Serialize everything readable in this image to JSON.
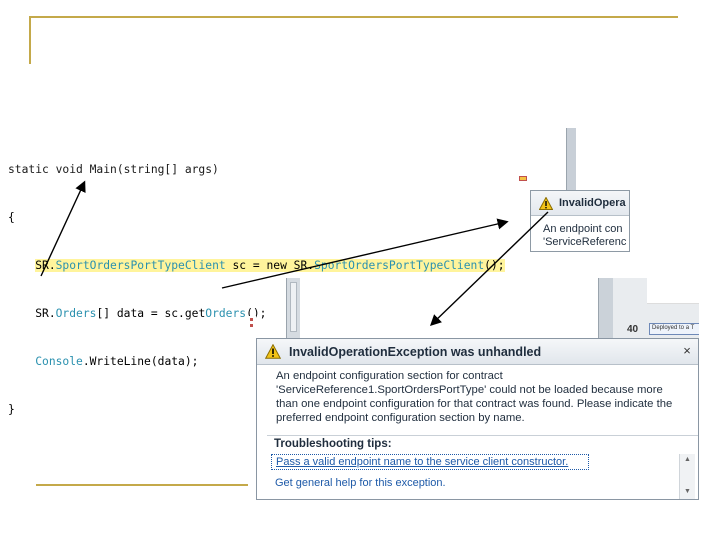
{
  "code": {
    "lines": [
      "static void Main(string[] args)",
      "{",
      "    SR.SportOrdersPortTypeClient sc = new SR.SportOrdersPortTypeClient();",
      "    SR.Orders[] data = sc.getOrders();",
      "    Console.WriteLine(data);",
      "}"
    ]
  },
  "mini_popup": {
    "title": "InvalidOpera",
    "line1": "An endpoint con",
    "line2": "'ServiceReferenc"
  },
  "right_panel": {
    "line_number": "40",
    "tag_text": "Deployed to a T"
  },
  "dialog": {
    "title": "InvalidOperationException was unhandled",
    "close": "×",
    "message_lines": [
      "An endpoint configuration section for contract",
      "'ServiceReference1.SportOrdersPortType' could not be loaded because more",
      "than one endpoint configuration for that contract was found. Please indicate the",
      "preferred endpoint configuration section by name."
    ],
    "tips_heading": "Troubleshooting tips:",
    "tips": [
      "Pass a valid endpoint name to the service client constructor.",
      "Get general help for this exception."
    ]
  },
  "icons": {
    "warning": "warning-icon",
    "close": "close-icon"
  },
  "colors": {
    "accent_gold": "#c4a94a",
    "highlight": "#fff49c",
    "type_color": "#2b91af",
    "link": "#1e5aa8",
    "warning": "#f2c318"
  }
}
